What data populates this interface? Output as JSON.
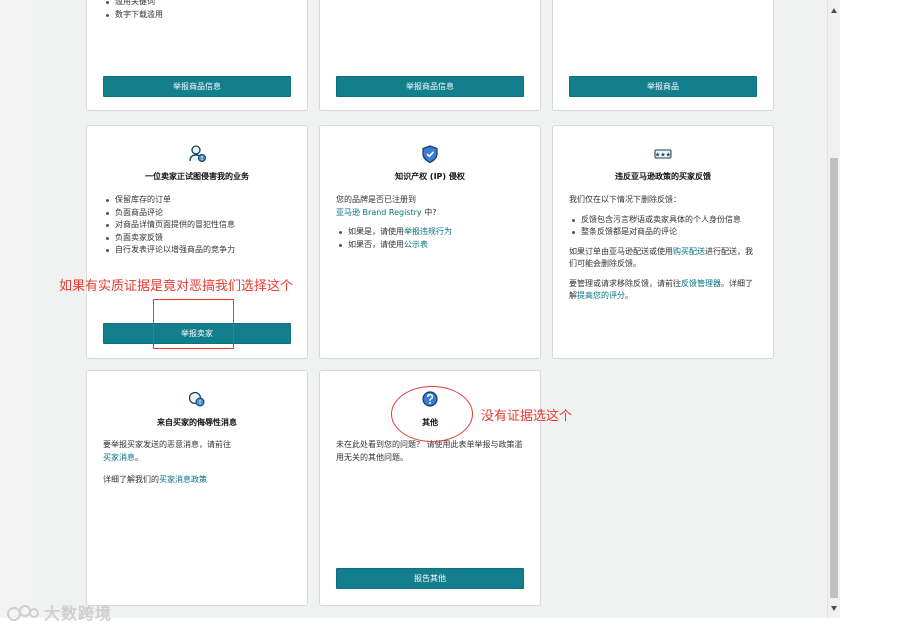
{
  "cards": {
    "top_left": {
      "bullets": [
        "滥用关键词",
        "数字下载滥用"
      ],
      "button": "举报商品信息"
    },
    "top_middle": {
      "button": "举报商品信息"
    },
    "top_right": {
      "button": "举报商品"
    },
    "seller_interfering": {
      "icon": "person-warning-icon",
      "title": "一位卖家正试图侵害我的业务",
      "bullets": [
        "保留库存的订单",
        "负面商品评论",
        "对商品详情页面提供的冒犯性信息",
        "负面卖家反馈",
        "自行发表评论以增强商品的竞争力"
      ],
      "button": "举报卖家"
    },
    "ip_rights": {
      "icon": "shield-icon",
      "title": "知识产权 (IP) 侵权",
      "line1": "您的品牌是否已注册到",
      "line2_link": "亚马逊 Brand Registry",
      "line2_rest": " 中?",
      "bullet1_pre": "如果是，请使用",
      "bullet1_link": "举报违规行为",
      "bullet2_pre": "如果否，请使用",
      "bullet2_link": "公示表"
    },
    "buyer_feedback": {
      "icon": "stars-icon",
      "title": "违反亚马逊政策的买家反馈",
      "intro": "我们仅在以下情况下删除反馈：",
      "bullet1": "反馈包含污言秽语或卖家具体的个人身份信息",
      "bullet2": "整条反馈都是对商品的评论",
      "p2_pre": "如果订单由亚马逊配送或使用",
      "p2_link": "购买配送",
      "p2_mid": "进行配送，我们可能会删除反馈。",
      "p3_pre": "要管理或请求移除反馈，请前往",
      "p3_link": "反馈管理器",
      "p3_mid": "。详细了解",
      "p3_link2": "提高您的评分",
      "p3_end": "。"
    },
    "abusive_messages": {
      "icon": "chat-warning-icon",
      "title": "来自买家的侮辱性消息",
      "line1": "要举报买家发送的恶意消息，请前往",
      "line2_link": "买家消息",
      "line2_end": "。",
      "line3_pre": "详细了解我们的",
      "line3_link": "买家消息政策"
    },
    "other": {
      "icon": "question-icon",
      "title": "其他",
      "text": "未在此处看到您的问题？ 请使用此表单举报与政策滥用无关的其他问题。",
      "button": "报告其他"
    }
  },
  "annotations": {
    "note_seller": "如果有实质证据是竟对恶搞我们选择这个",
    "note_other": "没有证据选这个"
  },
  "watermark": {
    "text": "大数跨境"
  },
  "colors": {
    "button": "#137e8c",
    "link": "#007185",
    "annotation": "#e83a2f",
    "page_bg": "#f0f2f2"
  }
}
